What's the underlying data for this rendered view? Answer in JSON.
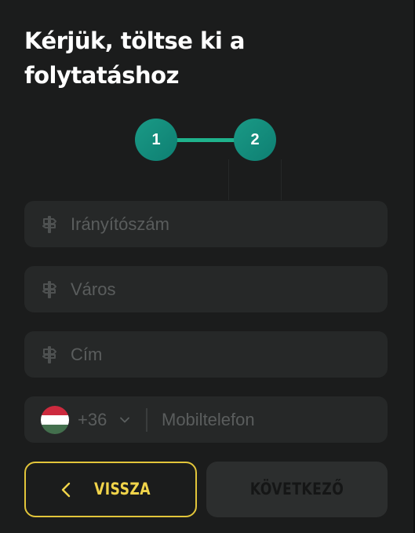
{
  "form": {
    "title": "Kérjük, töltse ki a folytatáshoz"
  },
  "stepper": {
    "steps": [
      {
        "number": "1"
      },
      {
        "number": "2"
      }
    ],
    "accent_color": "#1fb28c"
  },
  "fields": {
    "zip": {
      "placeholder": "Irányítószám",
      "value": "",
      "icon": "signpost-icon"
    },
    "city": {
      "placeholder": "Város",
      "value": "",
      "icon": "signpost-icon"
    },
    "address": {
      "placeholder": "Cím",
      "value": "",
      "icon": "signpost-icon"
    },
    "phone": {
      "country_flag": "hungary-flag-icon",
      "country_code": "+36",
      "placeholder": "Mobiltelefon",
      "value": ""
    }
  },
  "buttons": {
    "back_label": "VISSZA",
    "next_label": "KÖVETKEZŐ",
    "back_color": "#f1d44a"
  }
}
